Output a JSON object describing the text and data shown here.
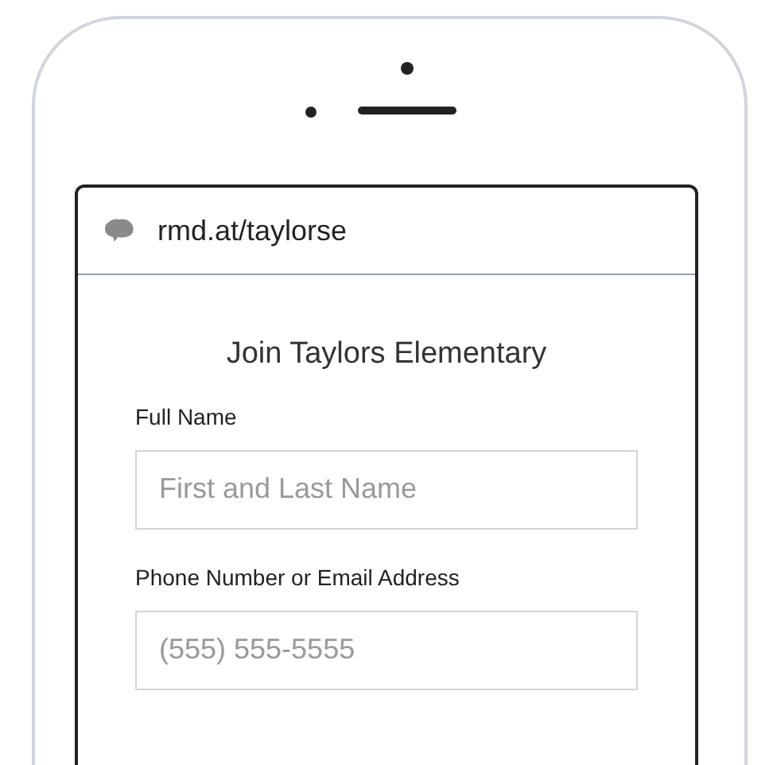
{
  "address_bar": {
    "url": "rmd.at/taylorse"
  },
  "form": {
    "title": "Join Taylors Elementary",
    "fields": [
      {
        "label": "Full Name",
        "placeholder": "First and Last Name"
      },
      {
        "label": "Phone Number or Email Address",
        "placeholder": "(555) 555-5555"
      }
    ]
  }
}
